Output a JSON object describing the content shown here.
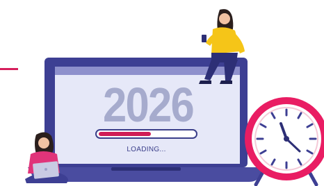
{
  "screen": {
    "year": "2026",
    "loading_label": "LOADING...",
    "progress_fraction": 0.55
  },
  "colors": {
    "accent": "#d61f5c",
    "laptop_frame": "#3d3f93",
    "screen_bg": "#e6e8f8",
    "year_text": "#a6abcd",
    "clock_rim": "#e91d63"
  },
  "icons": [
    "laptop-icon",
    "alarm-clock-icon",
    "woman-sitting-icon",
    "woman-with-laptop-icon"
  ]
}
